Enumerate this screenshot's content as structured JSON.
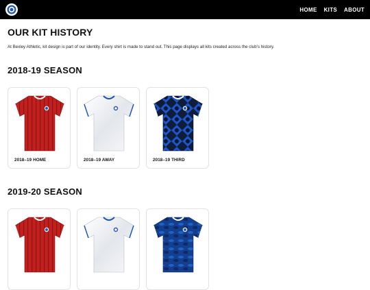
{
  "header": {
    "logo": "club-crest",
    "nav": [
      "HOME",
      "KITS",
      "ABOUT"
    ]
  },
  "page": {
    "title": "OUR KIT HISTORY",
    "intro": "At Bexley Athletic, kit design is part of our identity. Every shirt is made to stand out. This page displays all kits created across the club’s history."
  },
  "seasons": [
    {
      "title": "2018-19 SEASON",
      "kits": [
        {
          "label": "2018–19 HOME",
          "style": "red-stripes"
        },
        {
          "label": "2018–19 AWAY",
          "style": "white-marble"
        },
        {
          "label": "2018–19 THIRD",
          "style": "blue-geometric"
        }
      ]
    },
    {
      "title": "2019-20 SEASON",
      "kits": [
        {
          "label": "",
          "style": "red-stripes"
        },
        {
          "label": "",
          "style": "white-marble"
        },
        {
          "label": "",
          "style": "blue-camo"
        }
      ]
    }
  ],
  "colors": {
    "topbar": "#000000",
    "red_kit": "#c2211f",
    "blue_kit": "#1e56b8",
    "white_kit": "#f2f3f6"
  }
}
